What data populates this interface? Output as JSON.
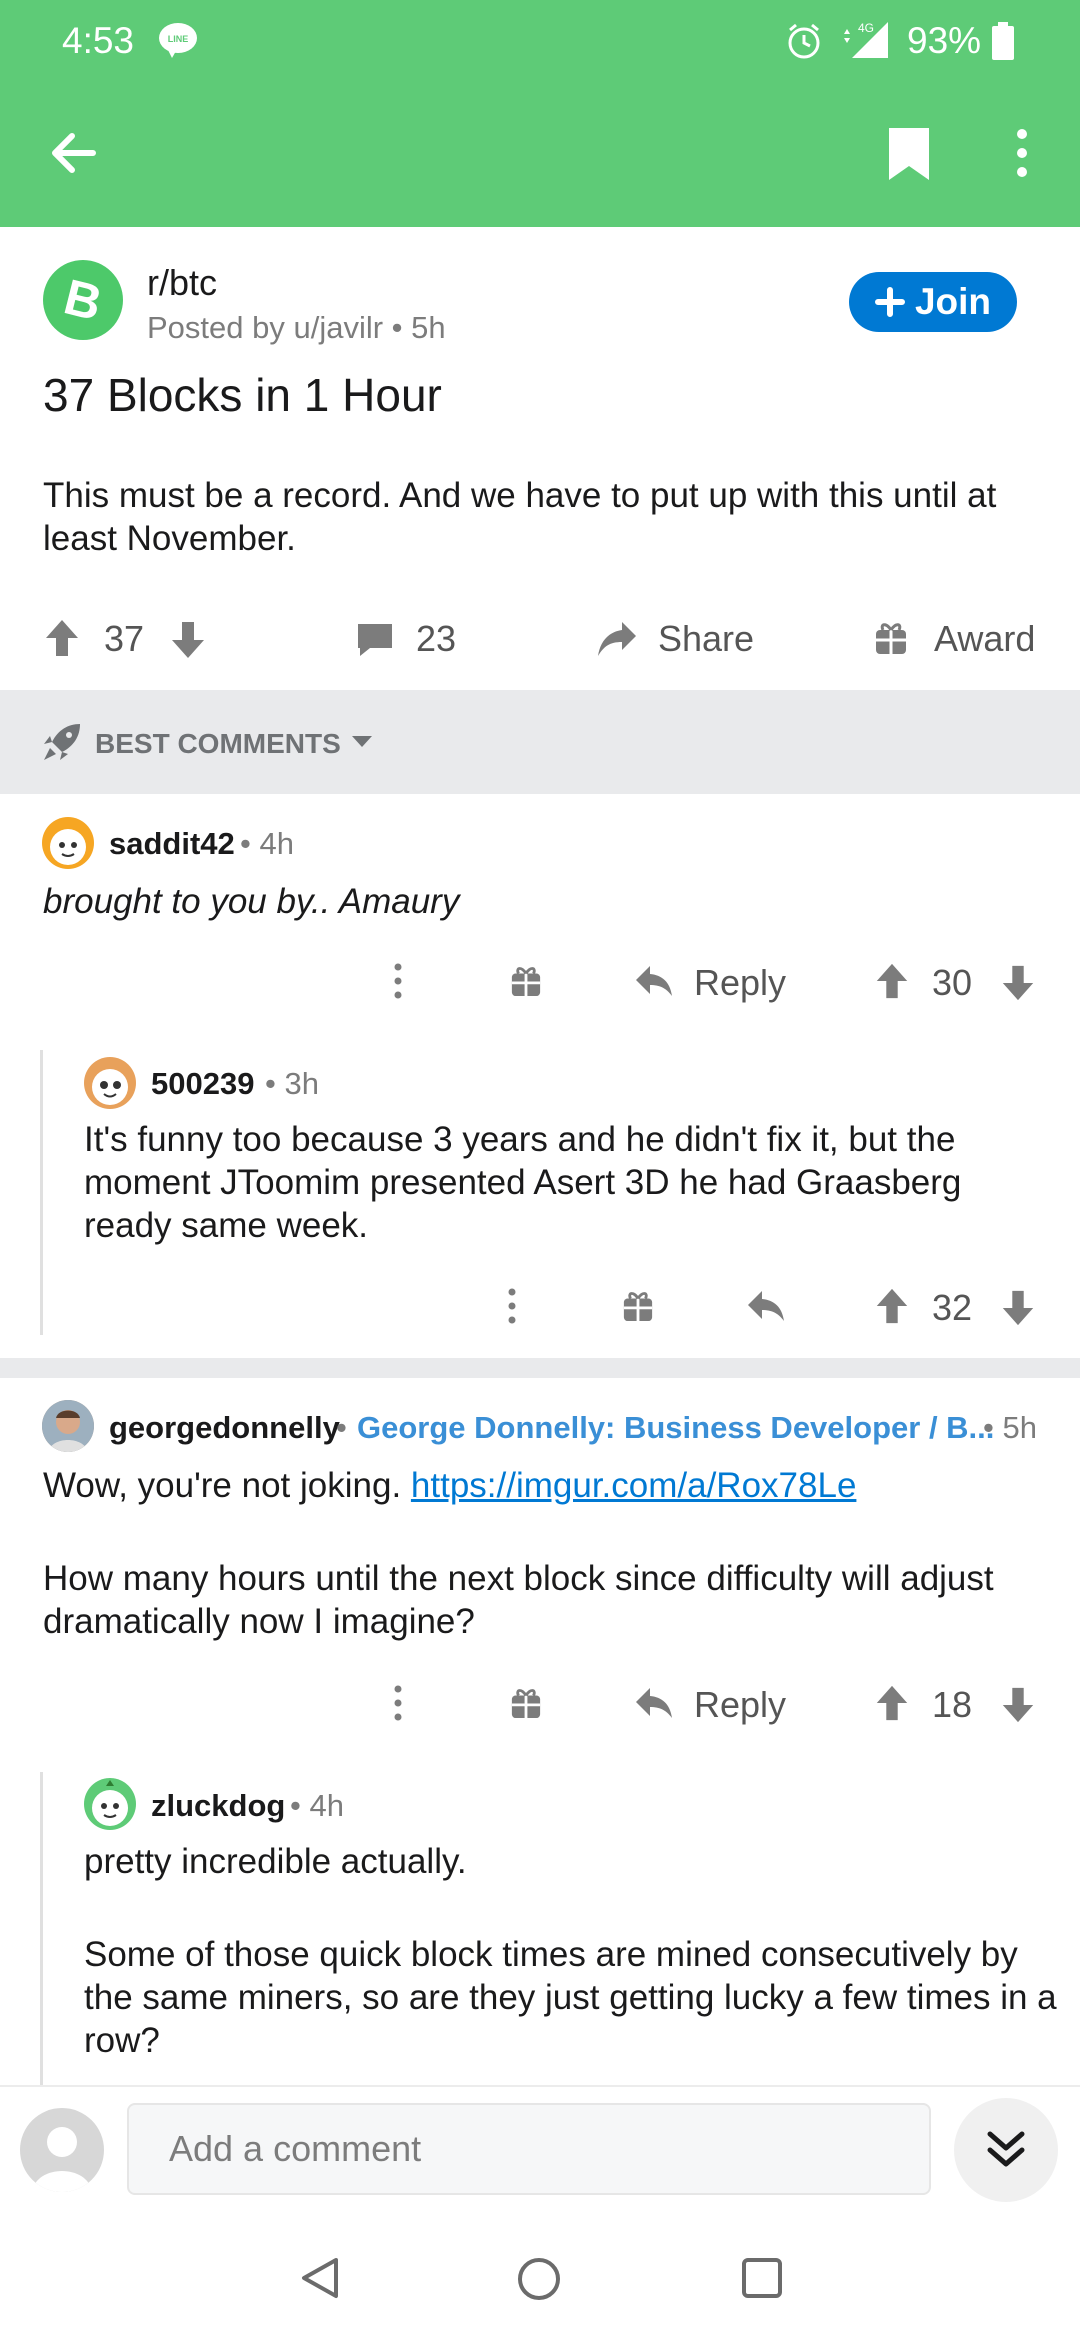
{
  "status_bar": {
    "time": "4:53",
    "battery": "93%",
    "network": "4G"
  },
  "post": {
    "subreddit": "r/btc",
    "posted_by": "Posted by u/javilr",
    "age": "5h",
    "join_label": "Join",
    "title": "37 Blocks in 1 Hour",
    "body": "This must be a record. And we have to put up with this until at least November.",
    "votes": "37",
    "comments": "23",
    "share_label": "Share",
    "award_label": "Award"
  },
  "sort": {
    "label": "BEST COMMENTS"
  },
  "comments": [
    {
      "author": "saddit42",
      "age": "4h",
      "text": "brought to you by.. Amaury",
      "reply_label": "Reply",
      "score": "30"
    },
    {
      "author": "500239",
      "age": "3h",
      "text": "It's funny too because 3 years and he didn't fix it, but the moment JToomim presented Asert 3D he had Graasberg ready same week.",
      "score": "32"
    },
    {
      "author": "georgedonnelly",
      "flair": "George Donnelly: Business Developer / B...",
      "age": "5h",
      "text_prefix": "Wow, you're not joking. ",
      "link": "https://imgur.com/a/Rox78Le",
      "text2": "How many hours until the next block since difficulty will adjust dramatically now I imagine?",
      "reply_label": "Reply",
      "score": "18"
    },
    {
      "author": "zluckdog",
      "age": "4h",
      "text1": "pretty incredible actually.",
      "text2": "Some of those quick block times are mined consecutively by the same miners, so are they just getting lucky a few times in a row?"
    }
  ],
  "composer": {
    "placeholder": "Add a comment"
  },
  "colors": {
    "header": "#5ecb77",
    "join": "#0079d3",
    "flair": "#3a8fd6"
  }
}
